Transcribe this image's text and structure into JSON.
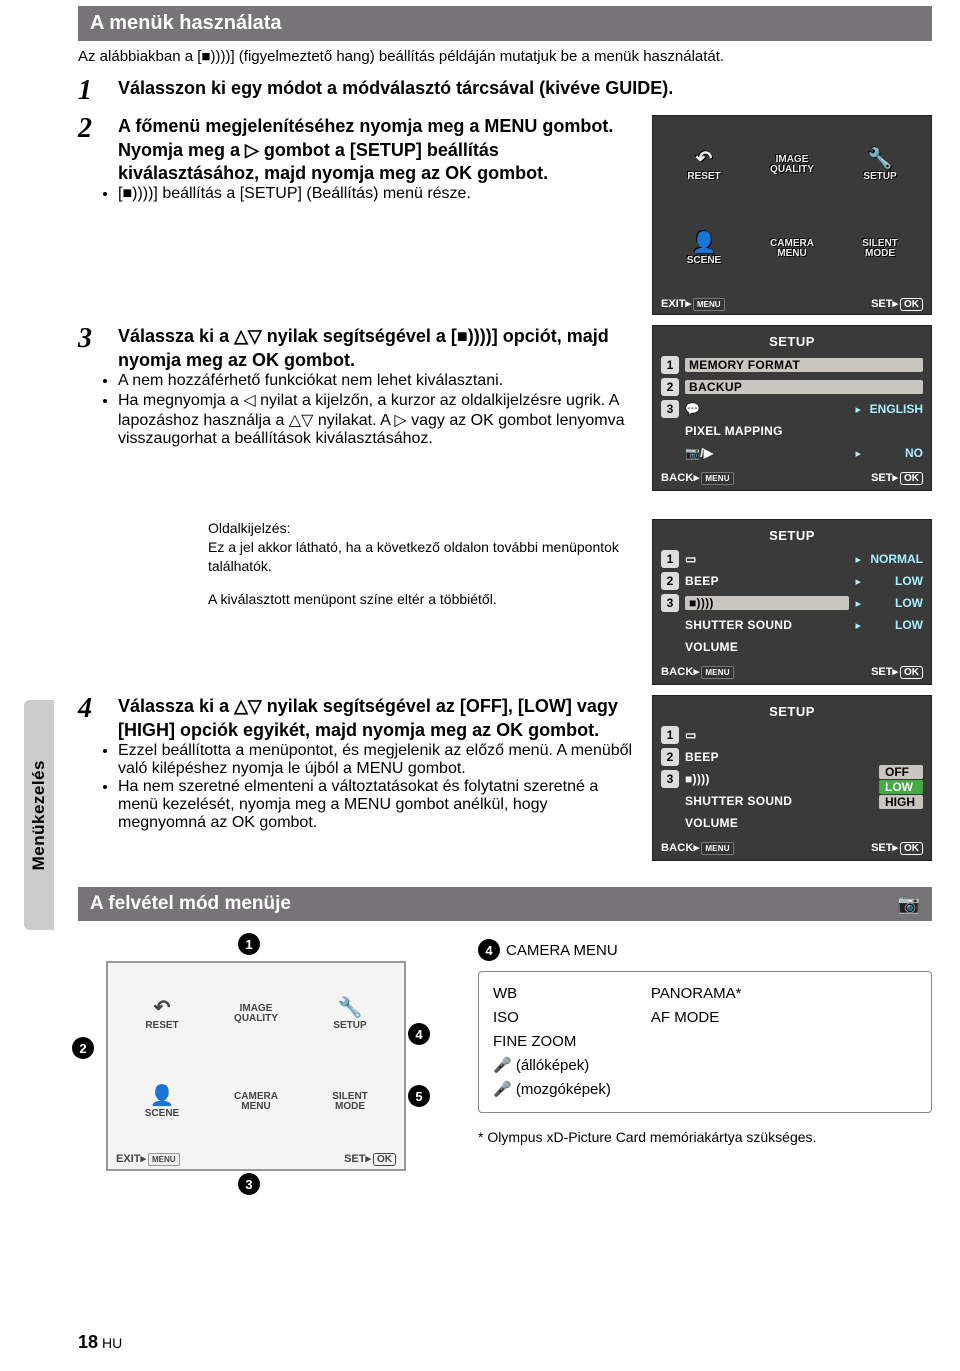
{
  "page": {
    "num": "18",
    "lang": "HU"
  },
  "headings": {
    "section1": "A menük használata",
    "section2": "A felvétel mód menüje"
  },
  "intro": "Az alábbiakban a [■))))] (figyelmeztető hang) beállítás példáján mutatjuk be a menük használatát.",
  "sidetab": "Menükezelés",
  "steps": {
    "s1": {
      "num": "1",
      "text": "Válasszon ki egy módot a módválasztó tárcsával (kivéve GUIDE)."
    },
    "s2": {
      "num": "2",
      "text": "A főmenü megjelenítéséhez nyomja meg a MENU gombot. Nyomja meg a ▷ gombot a [SETUP] beállítás kiválasztásához, majd nyomja meg az OK gombot.",
      "b1": "[■))))] beállítás a [SETUP] (Beállítás) menü része."
    },
    "s3": {
      "num": "3",
      "text": "Válassza ki a △▽ nyilak segítségével a [■))))] opciót, majd nyomja meg az OK gombot.",
      "b1": "A nem hozzáférhető funkciókat nem lehet kiválasztani.",
      "b2": "Ha megnyomja a ◁ nyilat a kijelzőn, a kurzor az oldalkijelzésre ugrik. A lapozáshoz használja a △▽ nyilakat. A ▷ vagy az OK gombot lenyomva visszaugorhat a beállítások kiválasztásához."
    },
    "cap": {
      "l1": "Oldalkijelzés:",
      "l2": "Ez a jel akkor látható, ha a következő oldalon további menüpontok találhatók.",
      "l3": "A kiválasztott menüpont színe eltér a többiétől."
    },
    "s4": {
      "num": "4",
      "text": "Válassza ki a △▽ nyilak segítségével az [OFF], [LOW] vagy [HIGH] opciók egyikét, majd nyomja meg az OK gombot.",
      "b1": "Ezzel beállította a menüpontot, és megjelenik az előző menü. A menüből való kilépéshez nyomja le újból a MENU gombot.",
      "b2": "Ha nem szeretné elmenteni a változtatásokat és folytatni szeretné a menü kezelését, nyomja meg a MENU gombot anélkül, hogy megnyomná az OK gombot."
    }
  },
  "mainmenu": {
    "c1": "RESET",
    "c2": "IMAGE\nQUALITY",
    "c3": "SETUP",
    "c4": "SCENE",
    "c5": "CAMERA\nMENU",
    "c6": "SILENT\nMODE",
    "exit": "EXIT",
    "set": "SET"
  },
  "setup_pg1": {
    "title": "SETUP",
    "r1": "MEMORY FORMAT",
    "r2": "BACKUP",
    "r3_val": "ENGLISH",
    "r4": "PIXEL MAPPING",
    "r5_val": "NO",
    "back": "BACK",
    "set": "SET"
  },
  "setup_pg2": {
    "title": "SETUP",
    "r1_val": "NORMAL",
    "r2": "BEEP",
    "r2_val": "LOW",
    "r3_val": "LOW",
    "r4": "SHUTTER SOUND",
    "r4_val": "LOW",
    "r5": "VOLUME",
    "back": "BACK",
    "set": "SET"
  },
  "setup_pg3": {
    "title": "SETUP",
    "r2": "BEEP",
    "r4": "SHUTTER SOUND",
    "r5": "VOLUME",
    "opts": {
      "o1": "OFF",
      "o2": "LOW",
      "o3": "HIGH"
    },
    "back": "BACK",
    "set": "SET"
  },
  "bottom": {
    "b4": "CAMERA MENU",
    "col1": {
      "a": "WB",
      "b": "ISO",
      "c": "FINE ZOOM",
      "d": "🎤 (állóképek)",
      "e": "🎤 (mozgóképek)"
    },
    "col2": {
      "a": "PANORAMA*",
      "b": "AF MODE"
    },
    "note": "* Olympus xD-Picture Card memóriakártya szükséges.",
    "badges": {
      "b1": "1",
      "b2": "2",
      "b3": "3",
      "b4": "4",
      "b5": "5"
    }
  }
}
